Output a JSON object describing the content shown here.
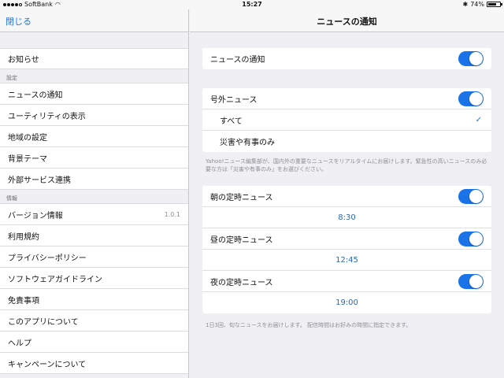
{
  "status_bar": {
    "carrier": "SoftBank",
    "time": "15:27",
    "battery": "74%",
    "battery_level": 0.74
  },
  "left": {
    "close_label": "閉じる",
    "top_items": [
      {
        "label": "お知らせ"
      }
    ],
    "settings_header": "設定",
    "settings_items": [
      {
        "label": "ニュースの通知"
      },
      {
        "label": "ユーティリティの表示"
      },
      {
        "label": "地域の設定"
      },
      {
        "label": "背景テーマ"
      },
      {
        "label": "外部サービス連携"
      }
    ],
    "info_header": "情報",
    "info_items": [
      {
        "label": "バージョン情報",
        "value": "1.0.1"
      },
      {
        "label": "利用規約"
      },
      {
        "label": "プライバシーポリシー"
      },
      {
        "label": "ソフトウェアガイドライン"
      },
      {
        "label": "免責事項"
      },
      {
        "label": "このアプリについて"
      },
      {
        "label": "ヘルプ"
      },
      {
        "label": "キャンペーンについて"
      }
    ]
  },
  "right": {
    "title": "ニュースの通知",
    "news_notification": {
      "label": "ニュースの通知",
      "on": true
    },
    "extra": {
      "label": "号外ニュース",
      "on": true,
      "options": [
        "すべて",
        "災害や有事のみ"
      ],
      "selected": "すべて"
    },
    "extra_note": "Yahoo!ニュース編集部が、国内外の重要なニュースをリアルタイムにお届けします。緊急性の高いニュースのみ必要な方は「災害や有事のみ」をお選びください。",
    "scheduled": [
      {
        "label": "朝の定時ニュース",
        "on": true,
        "time": "8:30"
      },
      {
        "label": "昼の定時ニュース",
        "on": true,
        "time": "12:45"
      },
      {
        "label": "夜の定時ニュース",
        "on": true,
        "time": "19:00"
      }
    ],
    "scheduled_note": "1日3回、旬なニュースをお届けします。 配信時間はお好みの時間に指定できます。"
  }
}
